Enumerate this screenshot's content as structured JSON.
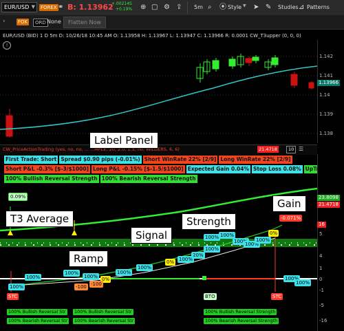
{
  "toolbar": {
    "symbol": "EUR/USD",
    "forex_badge": "FOREX",
    "bid_label": "B: 1.13962",
    "change_up": "+.00214S",
    "change_pct": "+0.19%",
    "timeframe": "5m",
    "style": "Style",
    "studies": "Studies",
    "patterns": "Patterns"
  },
  "toolbar2": {
    "flag_badge": "FOK",
    "ord_badge": "ORD",
    "none_label": "None",
    "flatten_button": "Flatten Now"
  },
  "price_header": {
    "text": "EUR/USD (BID) 1 D 5m   D: 10/26/18 10:45 AM   O: 1.13958   H: 1.13967   L: 1.13947   C: 1.13966   R: 0.0001   CW_T3upper (0, 0, 0)"
  },
  "price_axis": {
    "ticks": [
      "1.142",
      "1.141",
      "1.14",
      "1.139",
      "1.138"
    ],
    "current_price": "1.13966"
  },
  "study_header": {
    "text": "CW_PriceActionTrading (yes, no, no, ...  ...MPLE, 20, 2.0, 1.5, no, WILDERS, 6, 6)",
    "value": "21.4718",
    "field1": "10"
  },
  "label_panel": {
    "row1": [
      {
        "text": "First Trade: Short",
        "bg": "#3fe0e8"
      },
      {
        "text": "Spread $0.90 pips (-0.01%)",
        "bg": "#3fe0e8"
      },
      {
        "text": "Short WinRate 22% [2/9]",
        "bg": "#f2451f"
      },
      {
        "text": "Long WinRate 22% [2/9]",
        "bg": "#f2451f"
      }
    ],
    "row2": [
      {
        "text": "Short P&L -0.3% [$-3/$1000]",
        "bg": "#f2451f"
      },
      {
        "text": "Long P&L -0.15% [$-1.5/$1000]",
        "bg": "#f2451f"
      },
      {
        "text": "Expected Gain 0.04%",
        "bg": "#3fe0e8"
      },
      {
        "text": "Stop Loss 0.08%",
        "bg": "#3fe0e8"
      },
      {
        "text": "UpTrend",
        "bg": "#33dd33"
      }
    ],
    "row3": [
      {
        "text": "100% Bullish Reversal Strength",
        "bg": "#33dd33"
      },
      {
        "text": "100% Bearish Reversal Strength",
        "bg": "#33dd33"
      }
    ]
  },
  "study_axis": {
    "ticks": [
      "16",
      "5",
      "4",
      "1",
      "0",
      "-1",
      "-5",
      "-16"
    ],
    "tag_upper": "23.8098",
    "tag_lower": "21.4718",
    "tag_16": "16"
  },
  "callouts": {
    "label_panel": "Label Panel",
    "t3_average": "T3 Average",
    "signal": "Signal",
    "strength": "Strength",
    "gain": "Gain",
    "ramp": "Ramp"
  },
  "chart_bubbles": {
    "gain_pct_top": "0.09%",
    "gain_pct_right": "-0.071%",
    "stc_left": "STC",
    "stc_right": "STC",
    "bto": "BTO",
    "pct_100": "100%",
    "pct_0": "0%",
    "pct_20": "20%",
    "neg_100": "-100"
  },
  "bottom_labels": {
    "bullish": "100% Bullish Reversal Str",
    "bearish": "100% Bearish Reversal Str",
    "bullish2": "100% Bullish Reversal Strength",
    "bearish2": "100% Bearish Reversal Strength"
  },
  "colors": {
    "bull_candle": "#33ee33",
    "bear_candle": "#cc1111",
    "t3_line": "#33c6c6",
    "signal_line": "#33ee33"
  }
}
